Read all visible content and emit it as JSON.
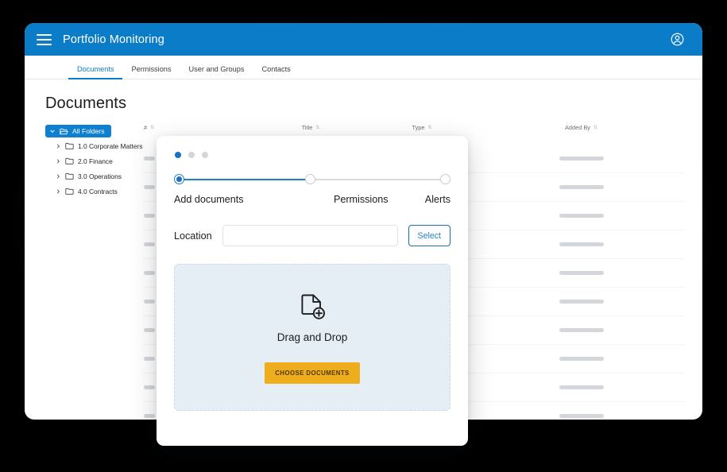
{
  "appbar": {
    "title": "Portfolio Monitoring",
    "menu_icon": "hamburger-menu-icon",
    "account_icon": "user-account-icon",
    "background_color": "#0b7dc8"
  },
  "tabs": [
    {
      "label": "Documents",
      "active": true
    },
    {
      "label": "Permissions",
      "active": false
    },
    {
      "label": "User and Groups",
      "active": false
    },
    {
      "label": "Contacts",
      "active": false
    }
  ],
  "page": {
    "title": "Documents"
  },
  "sidebar": {
    "root": {
      "label": "All Folders",
      "chevron": "chevron-down-icon",
      "icon": "folder-open-icon"
    },
    "items": [
      {
        "label": "1.0 Corporate Matters",
        "chevron": "chevron-right-icon",
        "icon": "folder-icon"
      },
      {
        "label": "2.0 Finance",
        "chevron": "chevron-right-icon",
        "icon": "folder-icon"
      },
      {
        "label": "3.0 Operations",
        "chevron": "chevron-right-icon",
        "icon": "folder-icon"
      },
      {
        "label": "4.0 Contracts",
        "chevron": "chevron-right-icon",
        "icon": "folder-icon"
      }
    ]
  },
  "table": {
    "columns": [
      {
        "label": "#",
        "sort": "⇅"
      },
      {
        "label": "Title",
        "sort": "⇅"
      },
      {
        "label": "Type",
        "sort": "⇅"
      },
      {
        "label": "Added By",
        "sort": "⇅"
      }
    ],
    "row_count": 10,
    "placeholder_note": "rows rendered as grey placeholder bars"
  },
  "modal": {
    "pager_dots": {
      "total": 3,
      "active_index": 0
    },
    "steps": [
      {
        "label": "Add documents",
        "state": "active"
      },
      {
        "label": "Permissions",
        "state": "upcoming"
      },
      {
        "label": "Alerts",
        "state": "upcoming"
      }
    ],
    "location": {
      "label": "Location",
      "value": "",
      "placeholder": "",
      "select_label": "Select"
    },
    "dropzone": {
      "icon": "file-add-icon",
      "text": "Drag and Drop",
      "button_label": "CHOOSE DOCUMENTS",
      "button_color": "#eead1c",
      "background_color": "#e6eef5"
    }
  },
  "theme": {
    "brand_blue": "#0b7dc8",
    "step_blue": "#1a7fc9",
    "amber": "#eead1c"
  }
}
